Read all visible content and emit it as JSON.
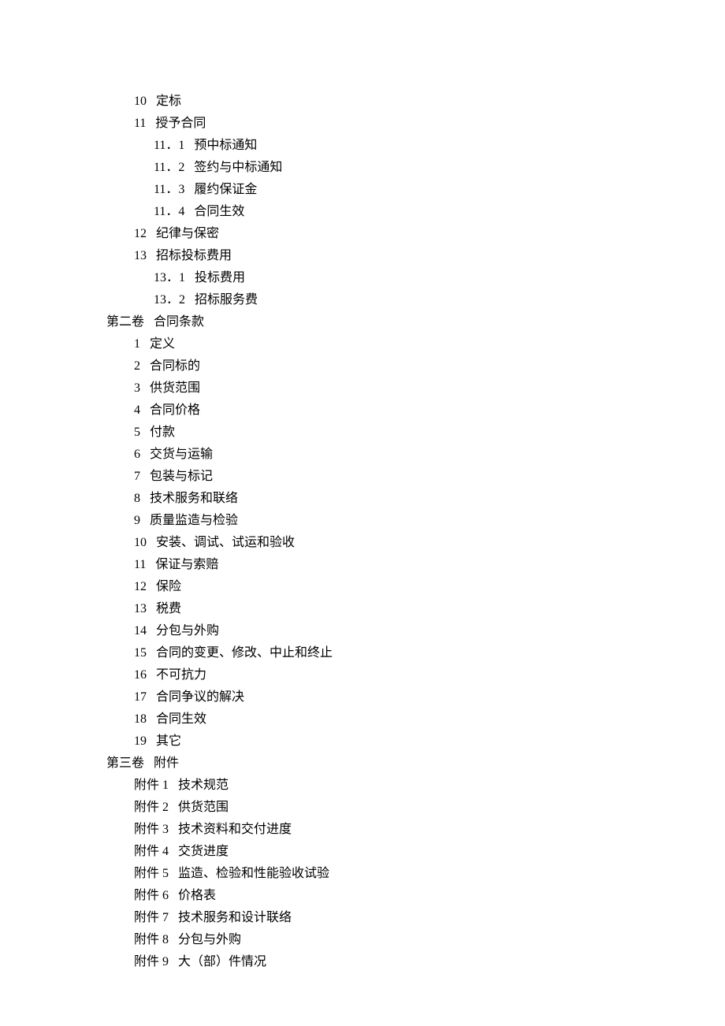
{
  "toc": [
    {
      "level": 1,
      "text": "10   定标"
    },
    {
      "level": 1,
      "text": "11   授予合同"
    },
    {
      "level": 2,
      "text": "11．1   预中标通知"
    },
    {
      "level": 2,
      "text": "11．2   签约与中标通知"
    },
    {
      "level": 2,
      "text": "11．3   履约保证金"
    },
    {
      "level": 2,
      "text": "11．4   合同生效"
    },
    {
      "level": 1,
      "text": "12   纪律与保密"
    },
    {
      "level": 1,
      "text": "13   招标投标费用"
    },
    {
      "level": 2,
      "text": "13．1   投标费用"
    },
    {
      "level": 2,
      "text": "13．2   招标服务费"
    },
    {
      "level": 0,
      "text": "第二卷   合同条款"
    },
    {
      "level": 1,
      "text": "1   定义"
    },
    {
      "level": 1,
      "text": "2   合同标的"
    },
    {
      "level": 1,
      "text": "3   供货范围"
    },
    {
      "level": 1,
      "text": "4   合同价格"
    },
    {
      "level": 1,
      "text": "5   付款"
    },
    {
      "level": 1,
      "text": "6   交货与运输"
    },
    {
      "level": 1,
      "text": "7   包装与标记"
    },
    {
      "level": 1,
      "text": "8   技术服务和联络"
    },
    {
      "level": 1,
      "text": "9   质量监造与检验"
    },
    {
      "level": 1,
      "text": "10   安装、调试、试运和验收"
    },
    {
      "level": 1,
      "text": "11   保证与索赔"
    },
    {
      "level": 1,
      "text": "12   保险"
    },
    {
      "level": 1,
      "text": "13   税费"
    },
    {
      "level": 1,
      "text": "14   分包与外购"
    },
    {
      "level": 1,
      "text": "15   合同的变更、修改、中止和终止"
    },
    {
      "level": 1,
      "text": "16   不可抗力"
    },
    {
      "level": 1,
      "text": "17   合同争议的解决"
    },
    {
      "level": 1,
      "text": "18   合同生效"
    },
    {
      "level": 1,
      "text": "19   其它"
    },
    {
      "level": 0,
      "text": "第三卷   附件"
    },
    {
      "level": 1,
      "text": "附件 1   技术规范"
    },
    {
      "level": 1,
      "text": "附件 2   供货范围"
    },
    {
      "level": 1,
      "text": "附件 3   技术资料和交付进度"
    },
    {
      "level": 1,
      "text": "附件 4   交货进度"
    },
    {
      "level": 1,
      "text": "附件 5   监造、检验和性能验收试验"
    },
    {
      "level": 1,
      "text": "附件 6   价格表"
    },
    {
      "level": 1,
      "text": "附件 7   技术服务和设计联络"
    },
    {
      "level": 1,
      "text": "附件 8   分包与外购"
    },
    {
      "level": 1,
      "text": "附件 9   大（部）件情况"
    }
  ]
}
